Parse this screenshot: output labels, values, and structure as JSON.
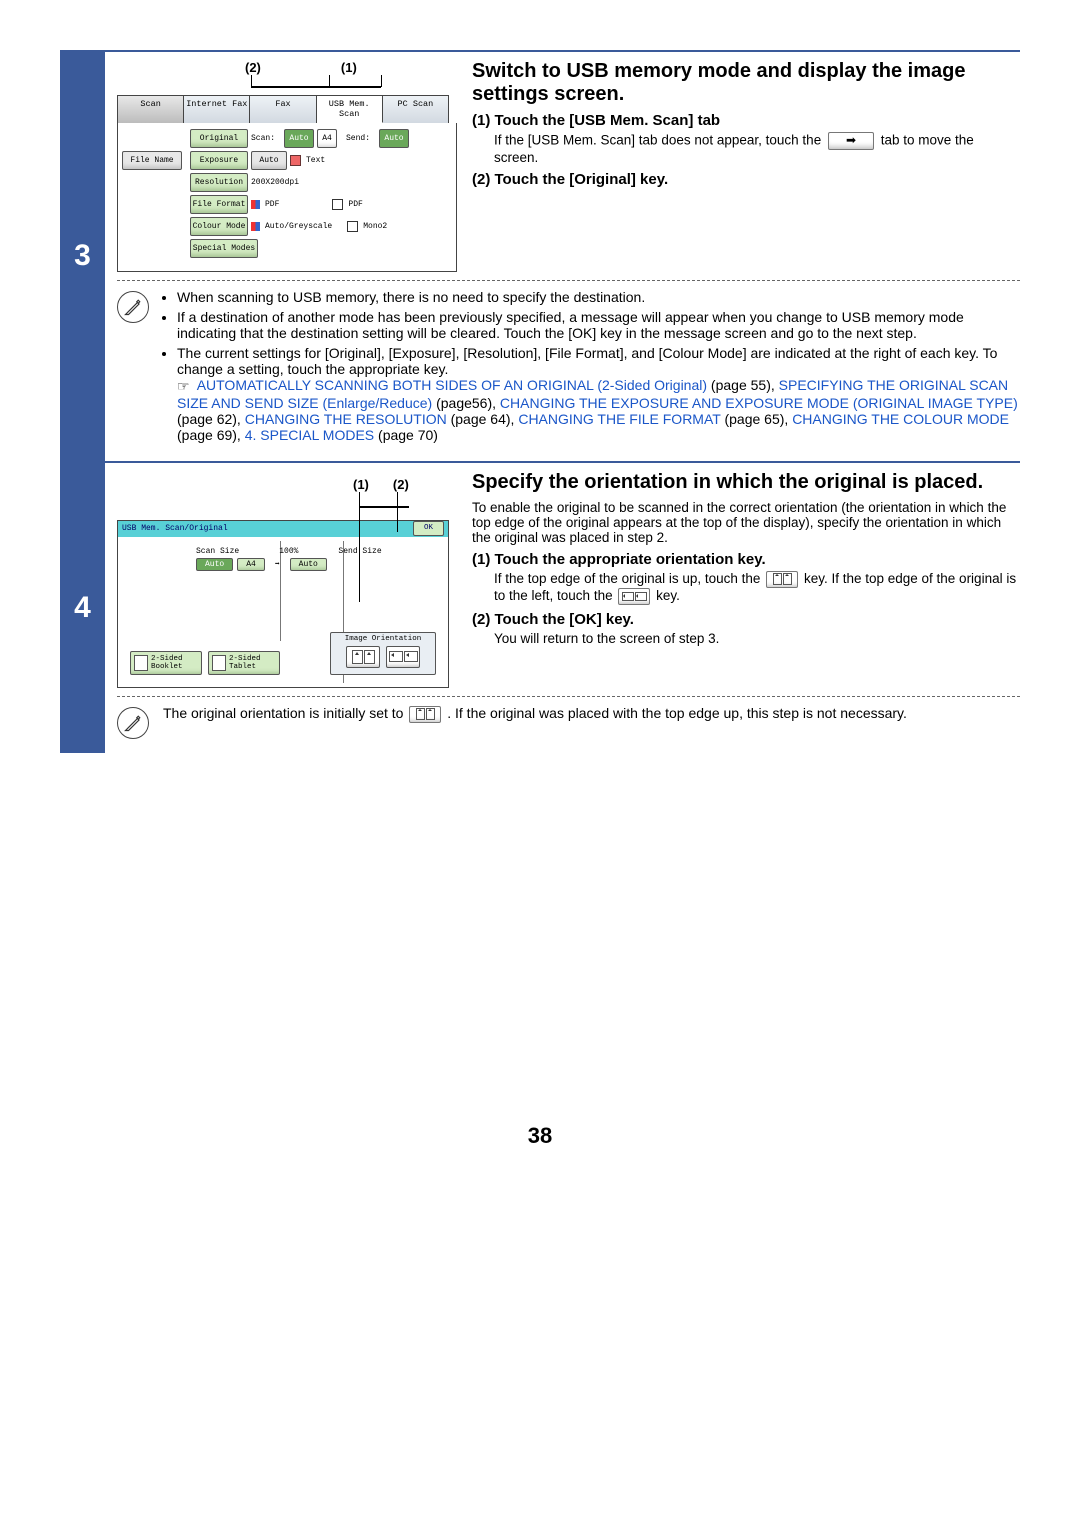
{
  "page_number": "38",
  "step3": {
    "number": "3",
    "callout_2": "(2)",
    "callout_1": "(1)",
    "tabs": {
      "scan": "Scan",
      "ifax": "Internet Fax",
      "fax": "Fax",
      "usb": "USB Mem. Scan",
      "pc": "PC Scan"
    },
    "rows": {
      "filename_left": "File Name",
      "original": "Original",
      "scan_lbl": "Scan:",
      "auto1": "Auto",
      "a4": "A4",
      "send_lbl": "Send:",
      "auto2": "Auto",
      "exposure": "Exposure",
      "auto3": "Auto",
      "text": "Text",
      "resolution": "Resolution",
      "res_val": "200X200dpi",
      "fileformat": "File Format",
      "pdf": "PDF",
      "pdf2": "PDF",
      "colour": "Colour Mode",
      "autog": "Auto/Greyscale",
      "mono": "Mono2",
      "special": "Special Modes"
    },
    "heading": "Switch to USB memory mode and display the image settings screen.",
    "item1_lead": "(1)  Touch the [USB Mem. Scan] tab",
    "item1_sub_a": "If the [USB Mem. Scan] tab does not appear, touch the",
    "item1_sub_b": "tab to move the screen.",
    "item2_lead": "(2)  Touch the [Original] key.",
    "note_b1": "When scanning to USB memory, there is no need to specify the destination.",
    "note_b2": "If a destination of another mode has been previously specified, a message will appear when you change to USB memory mode indicating that the destination setting will be cleared. Touch the [OK] key in the message screen and go to the next step.",
    "note_b3": "The current settings for [Original], [Exposure], [Resolution], [File Format], and [Colour Mode] are indicated at the right of each key. To change a setting, touch the appropriate key.",
    "links": {
      "l1": "AUTOMATICALLY SCANNING BOTH SIDES OF AN ORIGINAL (2-Sided Original)",
      "l1p": " (page 55), ",
      "l2": "SPECIFYING THE ORIGINAL SCAN SIZE AND SEND SIZE (Enlarge/Reduce)",
      "l2p": " (page56), ",
      "l3": "CHANGING THE EXPOSURE AND EXPOSURE MODE (ORIGINAL IMAGE TYPE)",
      "l3p": " (page 62), ",
      "l4": "CHANGING THE RESOLUTION",
      "l4p": " (page 64), ",
      "l5": "CHANGING THE FILE FORMAT",
      "l5p": " (page 65), ",
      "l6": "CHANGING THE COLOUR MODE",
      "l6p": " (page 69), ",
      "l7": "4. SPECIAL MODES",
      "l7p": " (page 70)"
    }
  },
  "step4": {
    "number": "4",
    "callout_1": "(1)",
    "callout_2": "(2)",
    "panel_title": "USB Mem. Scan/Original",
    "ok": "OK",
    "scan_size": "Scan Size",
    "hundred": "100%",
    "send_size": "Send Size",
    "auto": "Auto",
    "a4": "A4",
    "auto2": "Auto",
    "img_or": "Image Orientation",
    "booklet": "2-Sided\nBooklet",
    "tablet": "2-Sided\nTablet",
    "heading": "Specify the orientation in which the original is placed.",
    "intro": "To enable the original to be scanned in the correct orientation (the orientation in which the top edge of the original appears at the top of the display), specify the orientation in which the original was placed in step 2.",
    "item1_lead": "(1)  Touch the appropriate orientation key.",
    "item1_sub_a": "If the top edge of the original is up, touch the ",
    "item1_sub_b": " key. If the top edge of the original is to the left, touch the ",
    "item1_sub_c": " key.",
    "item2_lead": "(2)  Touch the [OK] key.",
    "item2_sub": "You will return to the screen of step 3.",
    "note_a": "The original orientation is initially set to ",
    "note_b": ". If the original was placed with the top edge up, this step is not necessary."
  }
}
